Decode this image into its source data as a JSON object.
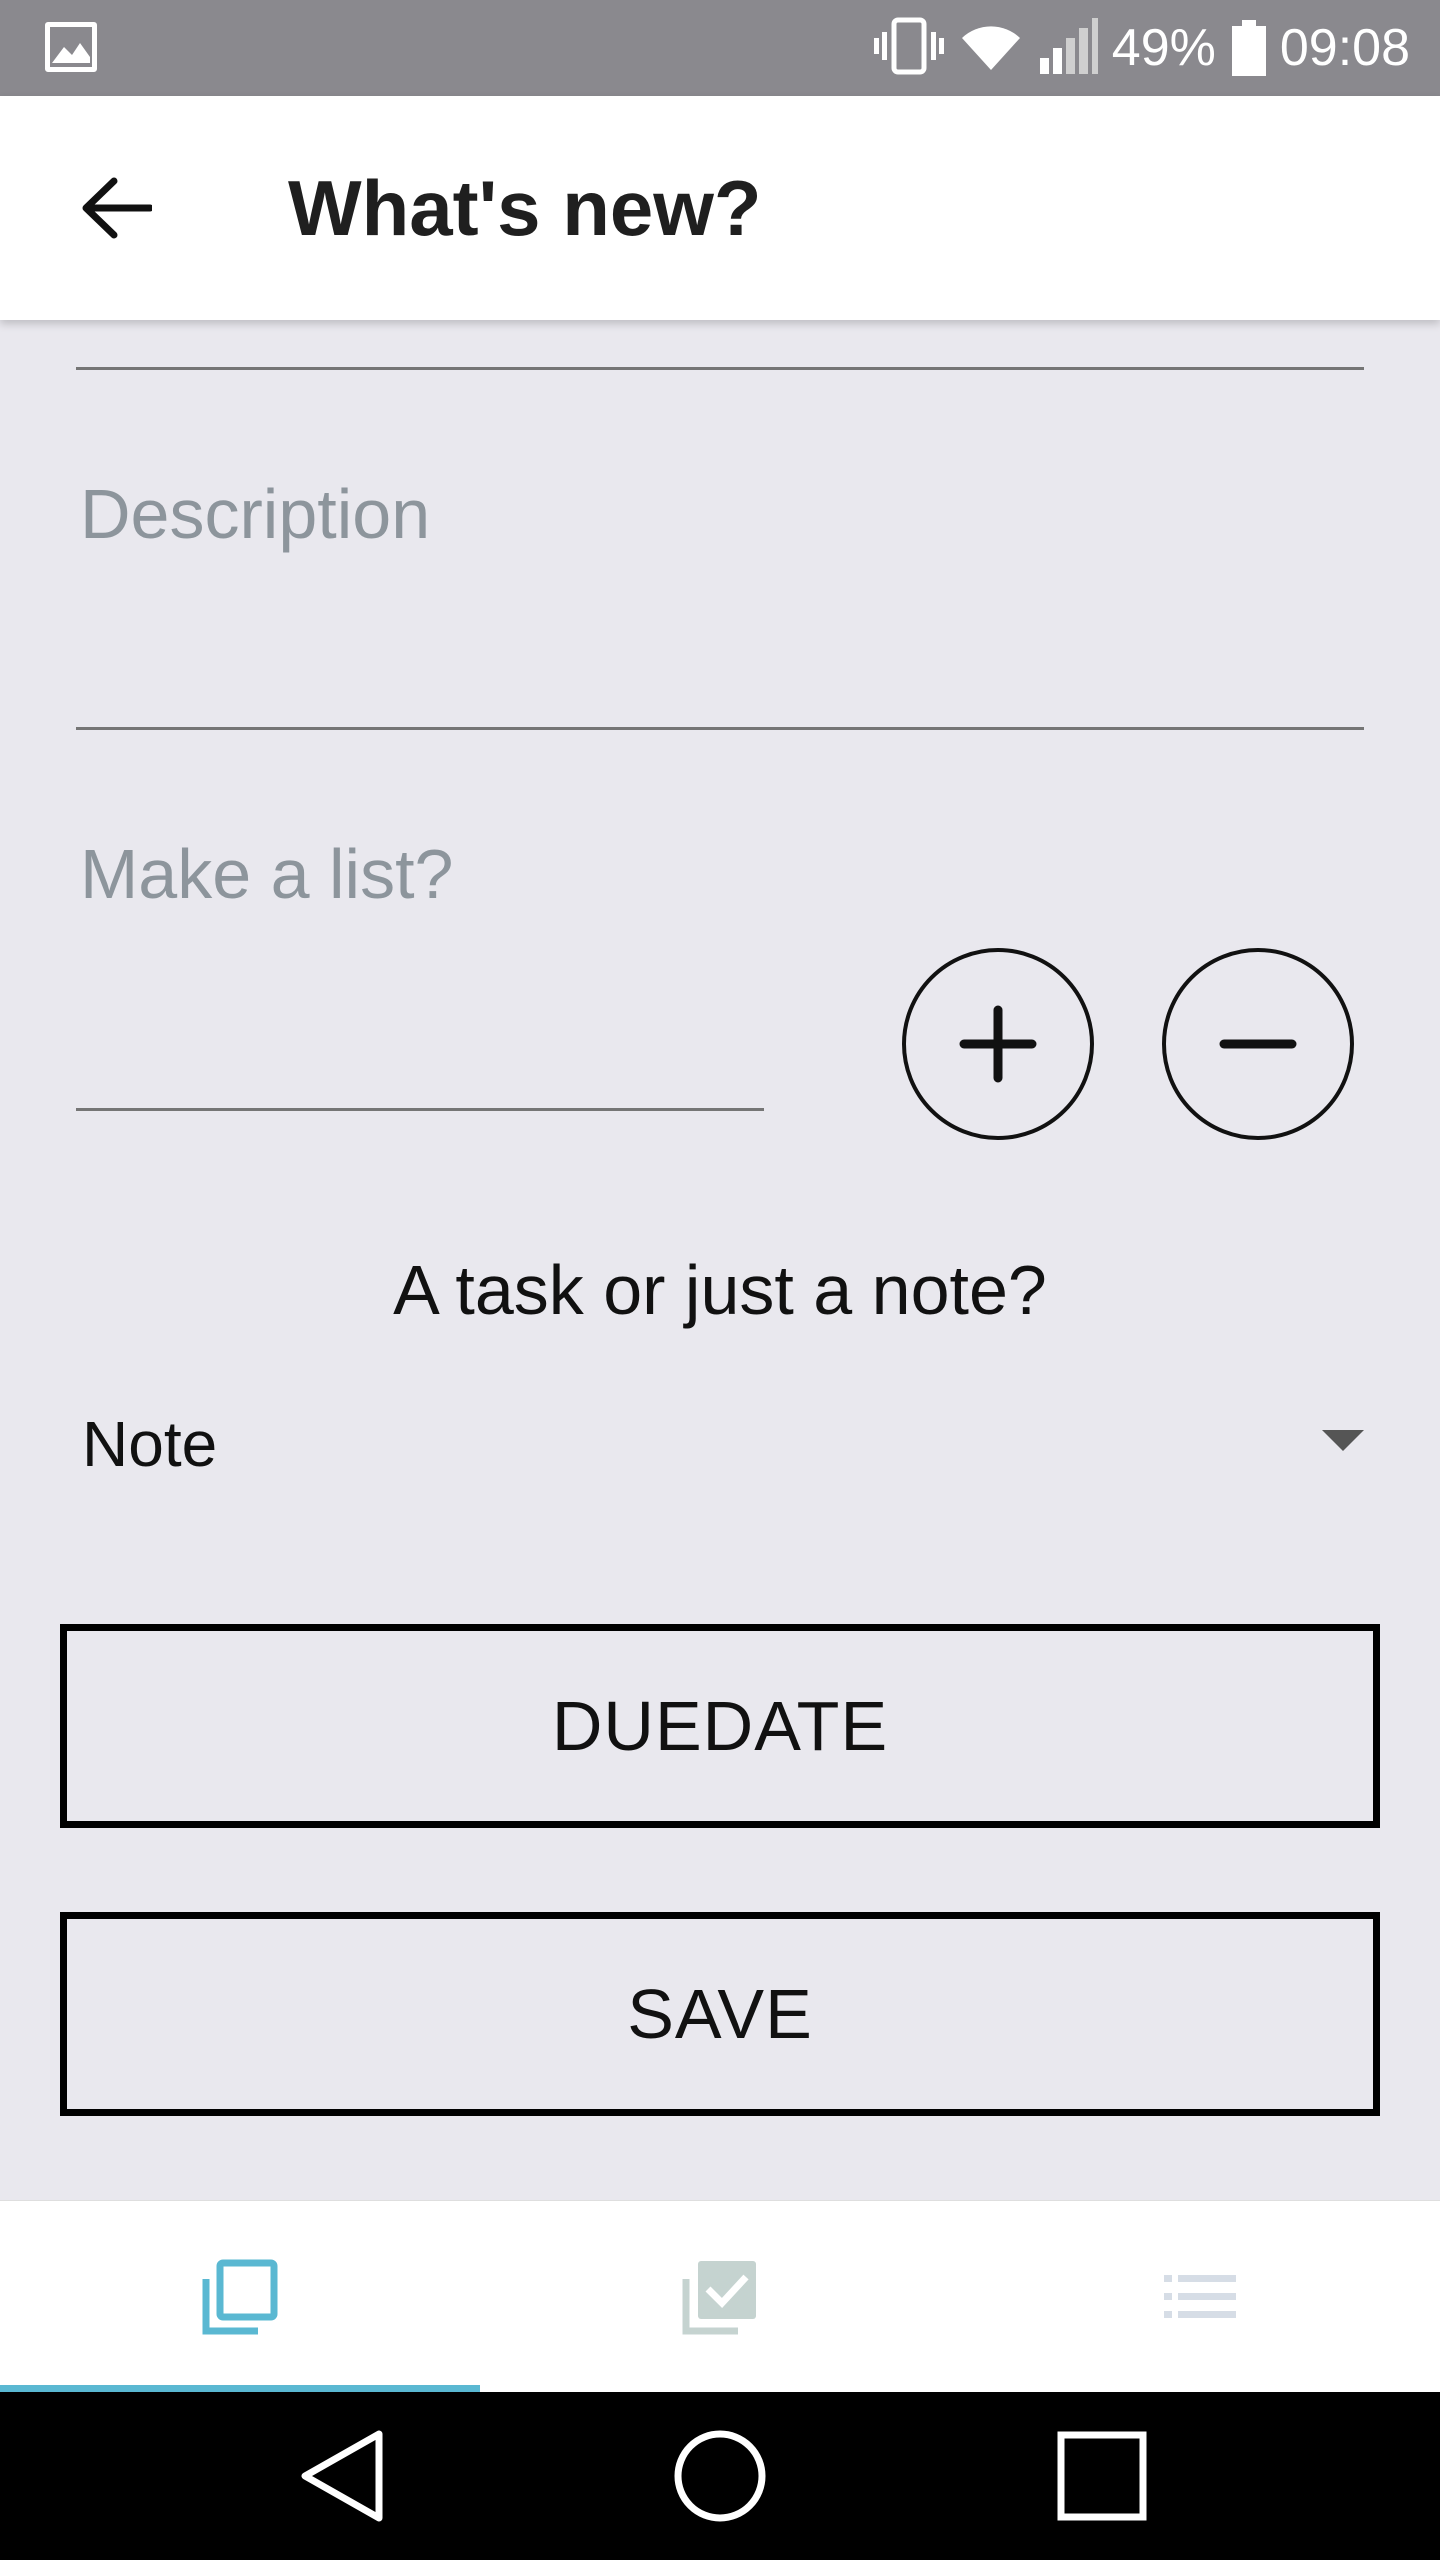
{
  "status_bar": {
    "battery_percent": "49%",
    "time": "09:08",
    "icons": [
      "gallery-icon",
      "vibrate-icon",
      "wifi-icon",
      "signal-icon",
      "battery-icon"
    ]
  },
  "app_bar": {
    "title": "What's new?",
    "back_icon": "arrow-left-icon"
  },
  "form": {
    "description_placeholder": "Description",
    "list_placeholder": "Make a list?",
    "add_icon": "plus-icon",
    "remove_icon": "minus-icon",
    "type_question": "A task or just a note?",
    "type_selected": "Note",
    "type_dropdown_icon": "caret-down-icon",
    "duedate_label": "DUEDATE",
    "save_label": "SAVE"
  },
  "tabs": [
    {
      "icon": "note-stack-icon",
      "active": true,
      "color": "#5ab8d2"
    },
    {
      "icon": "task-check-icon",
      "active": false,
      "color": "#c5d3d0"
    },
    {
      "icon": "list-icon",
      "active": false,
      "color": "#d6dde6"
    }
  ],
  "nav_bar": {
    "icons": [
      "back-triangle-icon",
      "home-circle-icon",
      "recents-square-icon"
    ]
  },
  "colors": {
    "background": "#e9e8ee",
    "accent": "#5ab8d2",
    "status_bar": "#8a898e",
    "placeholder": "#8d959c"
  }
}
